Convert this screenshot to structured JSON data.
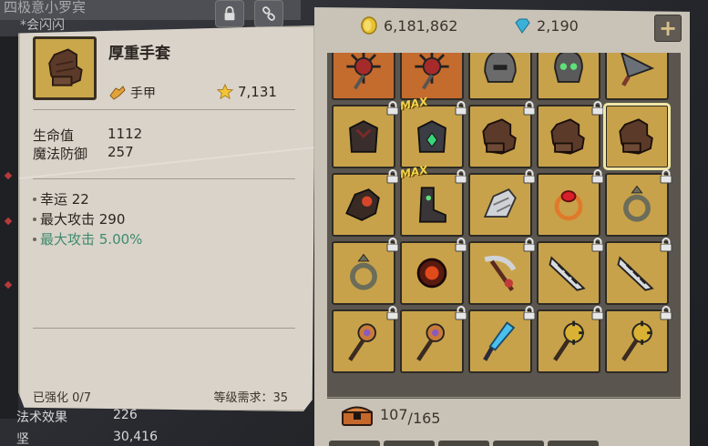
{
  "background": {
    "title": "四极意小罗宾",
    "subtitle": "*会闪闪",
    "stats": [
      {
        "label": "法术效果",
        "value": "226"
      },
      {
        "label": "坚",
        "value": "30,416"
      }
    ]
  },
  "detail": {
    "item_name": "厚重手套",
    "type_label": "手甲",
    "power": "7,131",
    "stats": [
      {
        "label": "生命值",
        "value": "1112"
      },
      {
        "label": "魔法防御",
        "value": "257"
      }
    ],
    "bonuses": [
      {
        "text": "幸运 22",
        "highlight": false
      },
      {
        "text": "最大攻击 290",
        "highlight": false
      },
      {
        "text": "最大攻击 5.00%",
        "highlight": true
      }
    ],
    "enhance": "已强化 0/7",
    "level_req": "等级需求：35"
  },
  "inventory": {
    "gold": "6,181,862",
    "gems": "2,190",
    "capacity_used": "107",
    "capacity_total": "/165",
    "slots": [
      {
        "icon": "spiked-amulet-icon",
        "bg": "orange",
        "locked": false,
        "max": false
      },
      {
        "icon": "spiked-amulet-icon",
        "bg": "orange",
        "locked": false,
        "max": false
      },
      {
        "icon": "helmet-icon",
        "bg": "gold",
        "locked": false,
        "max": false
      },
      {
        "icon": "skull-helmet-icon",
        "bg": "gold",
        "locked": false,
        "max": false
      },
      {
        "icon": "blade-icon",
        "bg": "gold",
        "locked": false,
        "max": false
      },
      {
        "icon": "dark-armor-icon",
        "bg": "gold",
        "locked": true,
        "max": false
      },
      {
        "icon": "gem-armor-icon",
        "bg": "gold",
        "locked": true,
        "max": true
      },
      {
        "icon": "heavy-glove-icon",
        "bg": "gold",
        "locked": true,
        "max": false
      },
      {
        "icon": "heavy-glove-icon",
        "bg": "gold",
        "locked": true,
        "max": false
      },
      {
        "icon": "heavy-glove-icon",
        "bg": "gold",
        "locked": false,
        "max": false,
        "selected": true
      },
      {
        "icon": "fire-gauntlet-icon",
        "bg": "gold",
        "locked": true,
        "max": false
      },
      {
        "icon": "armored-boots-icon",
        "bg": "gold",
        "locked": true,
        "max": true
      },
      {
        "icon": "steel-gauntlet-icon",
        "bg": "gold",
        "locked": true,
        "max": false
      },
      {
        "icon": "ruby-ring-icon",
        "bg": "gold",
        "locked": true,
        "max": false
      },
      {
        "icon": "silver-ring-icon",
        "bg": "gold",
        "locked": true,
        "max": false
      },
      {
        "icon": "silver-ring-icon",
        "bg": "gold",
        "locked": true,
        "max": false
      },
      {
        "icon": "ember-ring-icon",
        "bg": "gold",
        "locked": true,
        "max": false
      },
      {
        "icon": "scythe-icon",
        "bg": "gold",
        "locked": true,
        "max": false
      },
      {
        "icon": "claw-blade-icon",
        "bg": "gold",
        "locked": true,
        "max": false
      },
      {
        "icon": "claw-blade-icon",
        "bg": "gold",
        "locked": true,
        "max": false
      },
      {
        "icon": "eye-staff-icon",
        "bg": "gold",
        "locked": true,
        "max": false
      },
      {
        "icon": "eye-staff-icon",
        "bg": "gold",
        "locked": true,
        "max": false
      },
      {
        "icon": "crystal-staff-icon",
        "bg": "gold",
        "locked": true,
        "max": false
      },
      {
        "icon": "gold-mace-icon",
        "bg": "gold",
        "locked": true,
        "max": false
      },
      {
        "icon": "gold-mace-icon",
        "bg": "gold",
        "locked": true,
        "max": false
      }
    ]
  },
  "colors": {
    "gold_slot": "#c8a24a",
    "orange_slot": "#c46b2e",
    "bonus_green": "#3f8a6e",
    "gem_blue": "#3bb0d8"
  }
}
